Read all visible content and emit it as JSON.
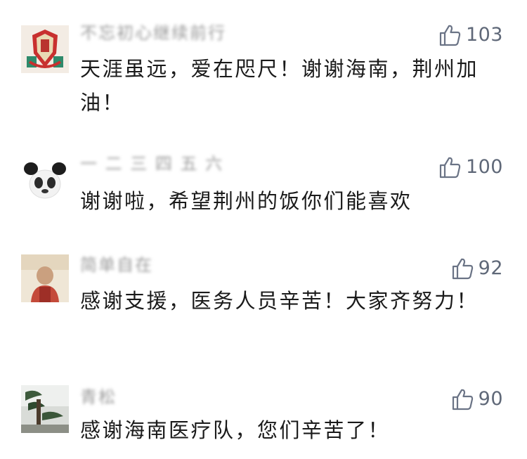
{
  "comments": [
    {
      "nickname": "不忘初心继续前行",
      "likes": "103",
      "text": "天涯虽远，爱在咫尺！谢谢海南，荆州加油！",
      "avatar_icon": "liverpool-crest-avatar"
    },
    {
      "nickname": "一 二 三 四 五 六",
      "likes": "100",
      "text": "谢谢啦，希望荆州的饭你们能喜欢",
      "avatar_icon": "panda-avatar"
    },
    {
      "nickname": "简单自在",
      "likes": "92",
      "text": "感谢支援，医务人员辛苦！大家齐努力！",
      "avatar_icon": "person-photo-avatar"
    },
    {
      "nickname": "青松",
      "likes": "90",
      "text": "感谢海南医疗队，您们辛苦了！",
      "avatar_icon": "pine-tree-avatar"
    }
  ],
  "colors": {
    "like_icon": "#6a7385",
    "text": "#1a1a1a",
    "nickname": "#9a9a9a"
  }
}
